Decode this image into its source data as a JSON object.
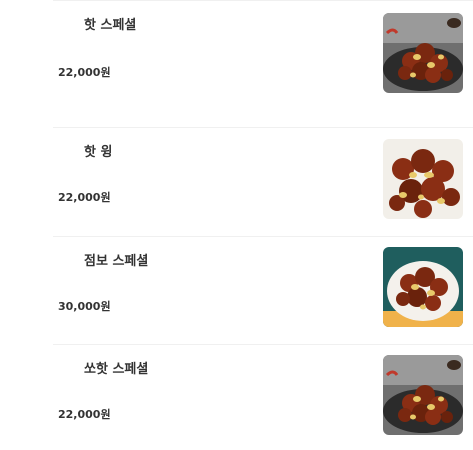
{
  "menu": {
    "items": [
      {
        "name": "핫 스페셜",
        "price": "22,000원",
        "image": "fried-chicken-dark-plate-icon"
      },
      {
        "name": "핫 윙",
        "price": "22,000원",
        "image": "chicken-wings-icon"
      },
      {
        "name": "점보 스페셜",
        "price": "30,000원",
        "image": "fried-chicken-teal-bg-icon"
      },
      {
        "name": "쏘핫 스페셜",
        "price": "22,000원",
        "image": "fried-chicken-dark-plate-icon"
      }
    ]
  },
  "colors": {
    "chicken": "#8a2e14",
    "chicken_dark": "#5a1b0a",
    "garlic": "#e8c96a",
    "plate_dark": "#2b2b2b",
    "bg_teal": "#1f5e5e"
  }
}
